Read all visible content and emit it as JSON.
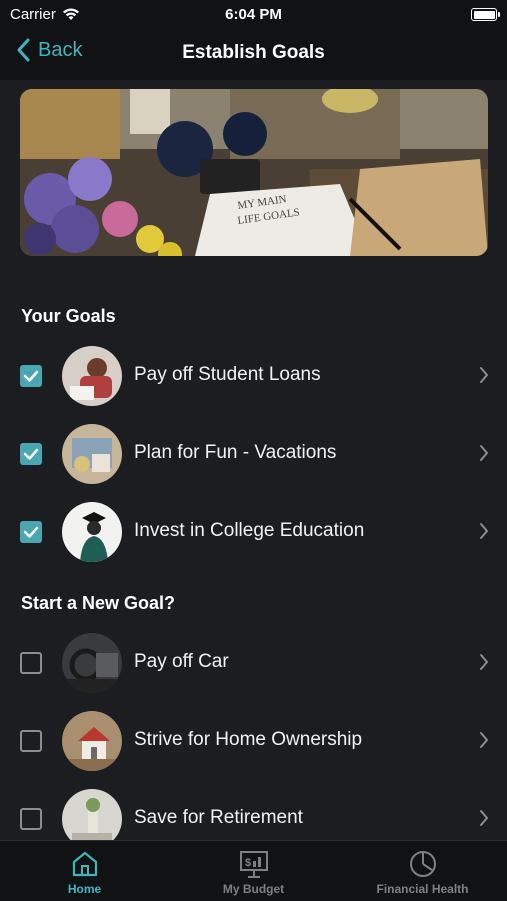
{
  "status": {
    "carrier": "Carrier",
    "time": "6:04 PM"
  },
  "nav": {
    "back_label": "Back",
    "title": "Establish Goals"
  },
  "sections": {
    "your_goals": "Your Goals",
    "new_goal": "Start a New Goal?"
  },
  "your_goals": [
    {
      "label": "Pay off Student Loans",
      "checked": true,
      "icon": "student-loans-photo"
    },
    {
      "label": "Plan for Fun - Vacations",
      "checked": true,
      "icon": "vacation-photo"
    },
    {
      "label": "Invest in College Education",
      "checked": true,
      "icon": "graduate-photo"
    }
  ],
  "new_goals": [
    {
      "label": "Pay off Car",
      "checked": false,
      "icon": "car-photo"
    },
    {
      "label": "Strive for Home Ownership",
      "checked": false,
      "icon": "house-photo"
    },
    {
      "label": "Save for Retirement",
      "checked": false,
      "icon": "retirement-photo"
    }
  ],
  "tabs": [
    {
      "label": "Home",
      "icon": "home-icon",
      "active": true
    },
    {
      "label": "My Budget",
      "icon": "budget-chart-icon",
      "active": false
    },
    {
      "label": "Financial Health",
      "icon": "pie-chart-icon",
      "active": false
    }
  ],
  "colors": {
    "accent": "#3fb5bd",
    "background": "#1b1d21",
    "bar": "#111214",
    "checkbox_on": "#4aa6b1",
    "tab_inactive": "#7d8085"
  }
}
